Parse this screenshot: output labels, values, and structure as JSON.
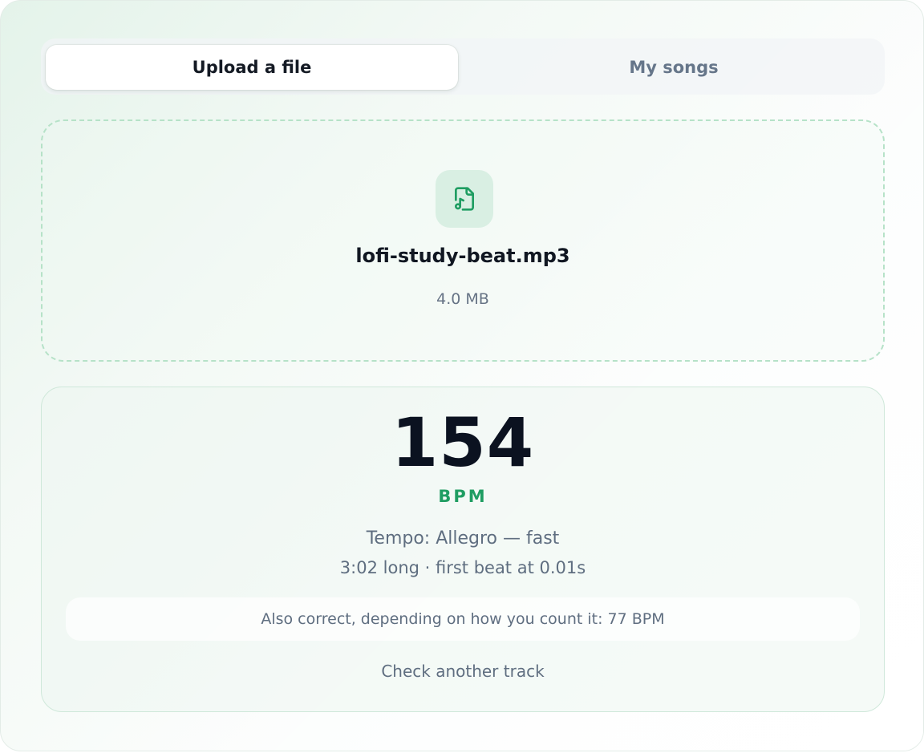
{
  "tabs": {
    "upload_label": "Upload a file",
    "songs_label": "My songs"
  },
  "file": {
    "icon": "music-file-icon",
    "name": "lofi-study-beat.mp3",
    "size": "4.0 MB"
  },
  "result": {
    "bpm": "154",
    "unit": "BPM",
    "tempo": "Tempo: Allegro — fast",
    "meta": "3:02 long · first beat at 0.01s",
    "alternate": "Also correct, depending on how you count it: 77 BPM",
    "again_label": "Check another track"
  },
  "colors": {
    "accent": "#1f9d62",
    "icon_bg": "#d9efe3",
    "dash_border": "#b6e2c8"
  }
}
